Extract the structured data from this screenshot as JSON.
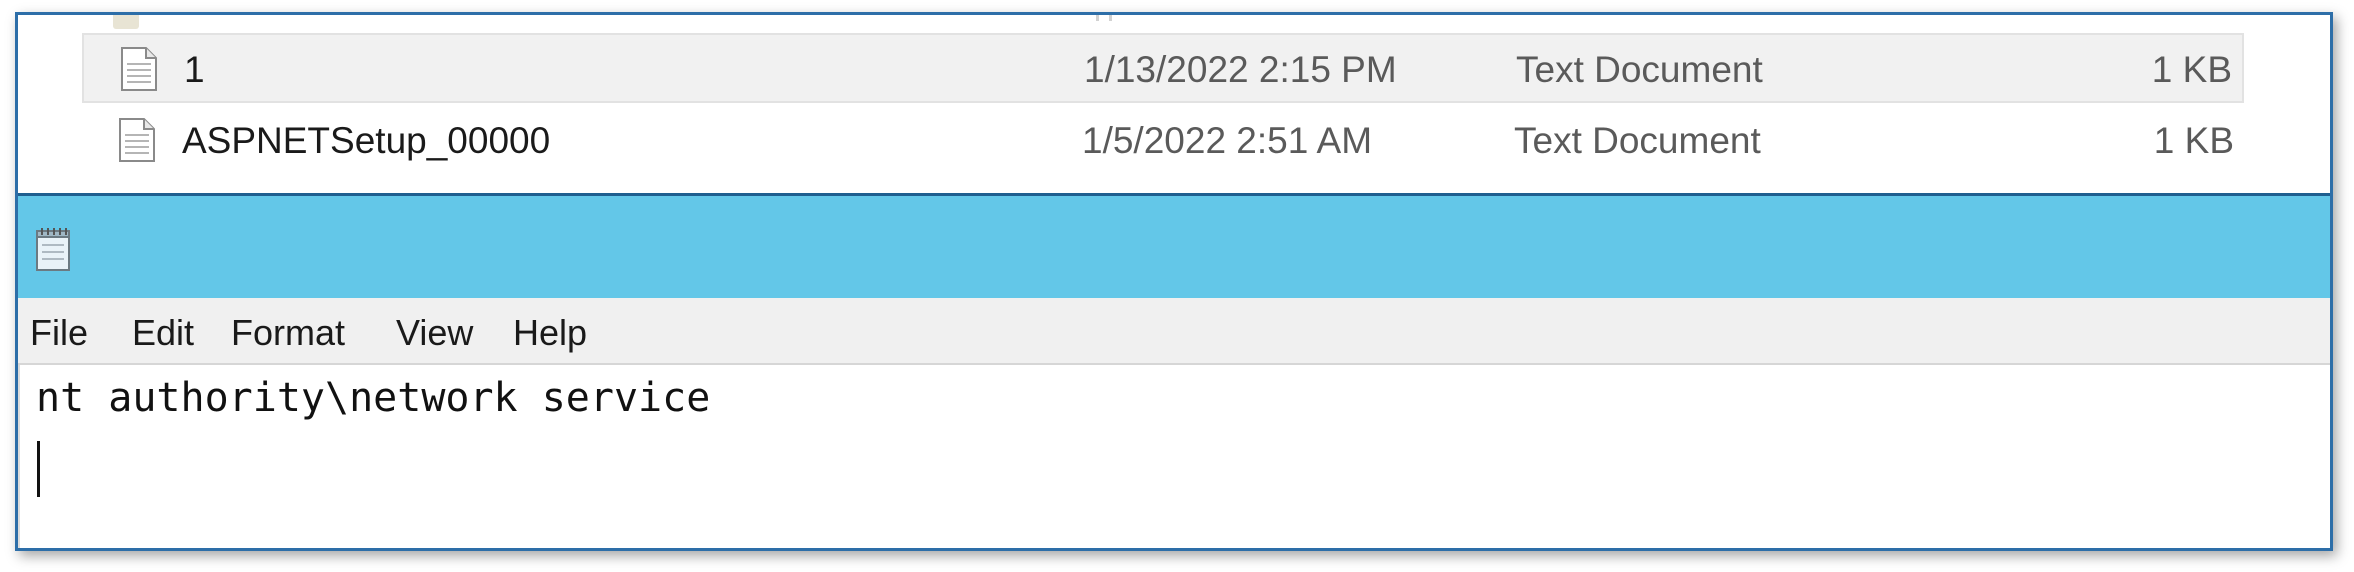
{
  "explorer": {
    "files": [
      {
        "name": "1",
        "date_modified": "1/13/2022 2:15 PM",
        "type": "Text Document",
        "size": "1 KB",
        "icon": "text-document-icon",
        "selected": true
      },
      {
        "name": "ASPNETSetup_00000",
        "date_modified": "1/5/2022 2:51 AM",
        "type": "Text Document",
        "size": "1 KB",
        "icon": "text-document-icon",
        "selected": false
      }
    ]
  },
  "notepad": {
    "app_icon": "notepad-icon",
    "menu": {
      "file": "File",
      "edit": "Edit",
      "format": "Format",
      "view": "View",
      "help": "Help"
    },
    "content_line": "nt authority\\network service"
  },
  "colors": {
    "titlebar": "#63c7e8",
    "frame_border": "#2d6ea8",
    "selected_row": "#f1f1f1"
  }
}
